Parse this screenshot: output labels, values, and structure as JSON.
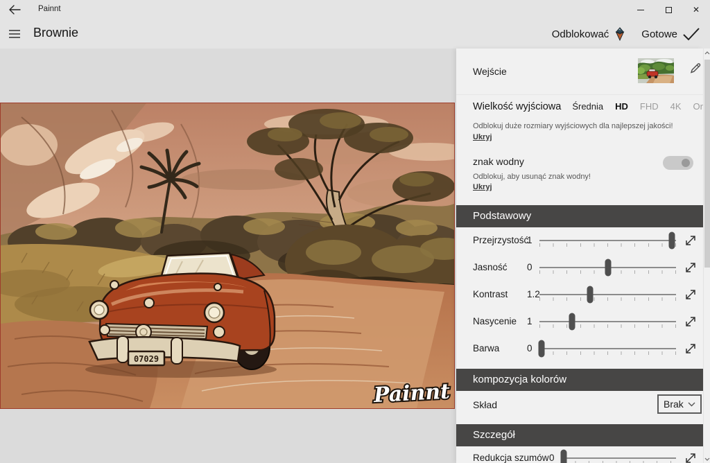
{
  "titlebar": {
    "app_title": "Painnt"
  },
  "header": {
    "style_name": "Brownie",
    "unlock_label": "Odblokować",
    "done_label": "Gotowe"
  },
  "canvas": {
    "watermark_text": "Painnt",
    "car_plate": "07029"
  },
  "panel": {
    "input_label": "Wejście",
    "output_size_label": "Wielkość wyjściowa",
    "size_options": [
      {
        "label": "Średnia",
        "state": "normal"
      },
      {
        "label": "HD",
        "state": "selected"
      },
      {
        "label": "FHD",
        "state": "locked"
      },
      {
        "label": "4K",
        "state": "locked"
      },
      {
        "label": "Oryginal",
        "state": "locked"
      }
    ],
    "size_note": "Odblokuj duże rozmiary wyjściowych dla najlepszej jakości!",
    "size_hide": "Ukryj",
    "watermark_label": "znak wodny",
    "watermark_toggle_on": true,
    "watermark_note": "Odblokuj, aby usunąć znak wodny!",
    "watermark_hide": "Ukryj",
    "section_basic": "Podstawowy",
    "sliders": [
      {
        "label": "Przejrzystość",
        "value": "1",
        "pos": 0.97
      },
      {
        "label": "Jasność",
        "value": "0",
        "pos": 0.5
      },
      {
        "label": "Kontrast",
        "value": "1.2",
        "pos": 0.37
      },
      {
        "label": "Nasycenie",
        "value": "1",
        "pos": 0.24
      },
      {
        "label": "Barwa",
        "value": "0",
        "pos": 0.015
      }
    ],
    "section_color": "kompozycja kolorów",
    "composition_label": "Skład",
    "composition_value": "Brak",
    "section_detail": "Szczegół",
    "detail_slider": {
      "label": "Redukcja szumów",
      "value": "0",
      "pos": 0.02
    }
  },
  "colors": {
    "section_header_bg": "#474645",
    "panel_bg": "#f1f1f1",
    "canvas_bg": "#dbdbdb",
    "chrome_bg": "#e4e4e4",
    "image_border": "#9e3d2c",
    "car_red": "#a8431f",
    "sepia_sky": "#c79276"
  }
}
